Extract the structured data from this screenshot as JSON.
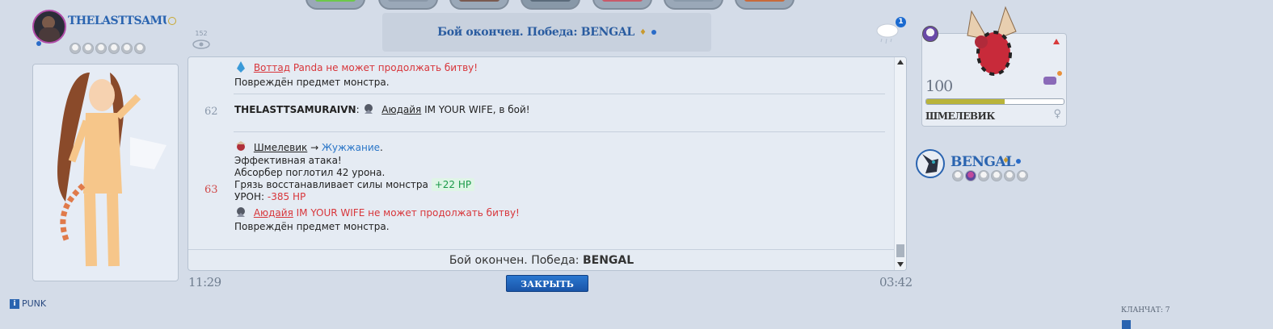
{
  "player_left": {
    "name": "THELASTTSAMURAIVN",
    "views": "152",
    "team_balls": 6
  },
  "header": {
    "result_title": "Бой окончен. Победа: BENGAL"
  },
  "weather": {
    "badge": "1"
  },
  "log": {
    "turns": [
      {
        "number": "",
        "lines": [
          {
            "actor": "Воттад",
            "text": " Panda не может продолжать битву!"
          },
          {
            "text": "Повреждён предмет монстра."
          }
        ]
      },
      {
        "number": "62",
        "lines": [
          {
            "trainer": "THELASTTSAMURAIVN",
            "sep": ": ",
            "actor": "Аюдайя",
            "text": " IM YOUR WIFE, в бой!"
          }
        ]
      },
      {
        "number": "63",
        "lines": [
          {
            "actor": "Шмелевик",
            "arrow": " → ",
            "move": "Жужжание",
            "dot": "."
          },
          {
            "text": "Эффективная атака!"
          },
          {
            "text": "Абсорбер поглотил 42 урона."
          },
          {
            "text": "Грязь восстанавливает силы монстра",
            "hp": "+22 HP"
          },
          {
            "text": "УРОН:",
            "dmg": "-385 HP"
          },
          {
            "actor": "Аюдайя",
            "text": " IM YOUR WIFE не может продолжать битву!"
          },
          {
            "text": "Повреждён предмет монстра."
          }
        ]
      }
    ],
    "footer_prefix": "Бой окончен. Победа:",
    "footer_winner": "BENGAL"
  },
  "times": {
    "left": "11:29",
    "right": "03:42"
  },
  "close_button": "ЗАКРЫТЬ",
  "monster_right": {
    "level": "100",
    "name": "ШМЕЛЕВИК",
    "hp_fraction": 0.57,
    "gender": "♀"
  },
  "player_right": {
    "name": "BENGAL",
    "team_balls": 6
  },
  "bottom_left_link": "PUNK",
  "clan_chat": "КЛАНЧАТ: 7",
  "colors": {
    "accent_blue": "#2a64b0",
    "danger_red": "#d8353a",
    "heal_green": "#1a9a48"
  }
}
